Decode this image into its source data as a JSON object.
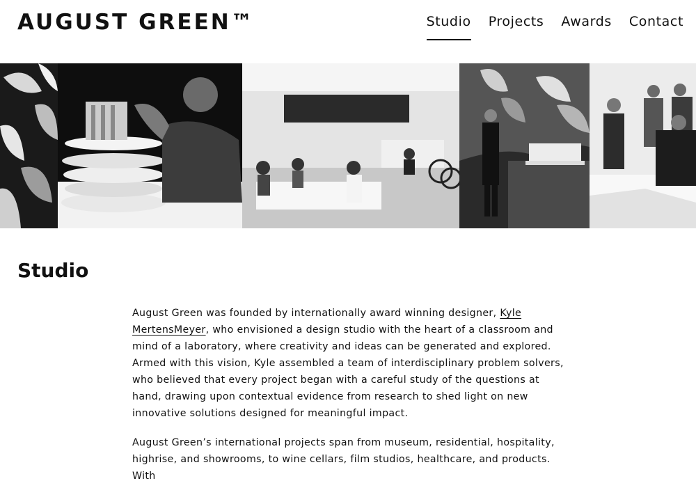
{
  "header": {
    "logo": "AUGUST GREEN™",
    "nav": [
      {
        "label": "Studio",
        "active": true
      },
      {
        "label": "Projects",
        "active": false
      },
      {
        "label": "Awards",
        "active": false
      },
      {
        "label": "Contact",
        "active": false
      }
    ]
  },
  "banner": {
    "photos": [
      "plants",
      "architectural-model-builder",
      "studio-workspace",
      "model-in-plant-room",
      "team-meeting"
    ]
  },
  "main": {
    "title": "Studio",
    "para1_start": "August Green was founded by internationally award winning designer, ",
    "founder_link": "Kyle MertensMeyer",
    "para1_end": ", who envisioned a design studio with the heart of a classroom and mind of a laboratory, where creativity and ideas can be generated and explored. Armed with this vision, Kyle assembled a team of interdisciplinary problem solvers, who believed that every project began with a careful study of the questions at hand, drawing upon contextual evidence from research to shed light on new innovative solutions designed for meaningful impact.",
    "para2": "August Green’s international projects span from museum, residential, hospitality, highrise, and showrooms, to wine cellars, film studios, healthcare, and products. With"
  }
}
